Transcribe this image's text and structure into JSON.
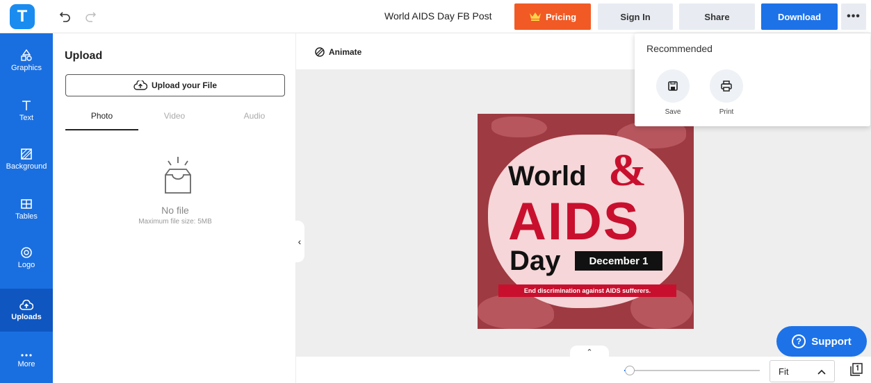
{
  "header": {
    "logo_letter": "T",
    "doc_title": "World AIDS Day FB Post",
    "pricing_label": "Pricing",
    "signin_label": "Sign In",
    "share_label": "Share",
    "download_label": "Download",
    "more_label": "•••"
  },
  "sidebar": {
    "items": [
      {
        "label": "Graphics",
        "icon": "graphics-icon"
      },
      {
        "label": "Text",
        "icon": "text-icon"
      },
      {
        "label": "Background",
        "icon": "background-icon"
      },
      {
        "label": "Tables",
        "icon": "tables-icon"
      },
      {
        "label": "Logo",
        "icon": "logo-icon"
      },
      {
        "label": "Uploads",
        "icon": "cloud-upload-icon",
        "active": true
      },
      {
        "label": "More",
        "icon": "more-icon"
      }
    ]
  },
  "panel": {
    "title": "Upload",
    "upload_button": "Upload your File",
    "tabs": [
      "Photo",
      "Video",
      "Audio"
    ],
    "empty_title": "No file",
    "empty_hint": "Maximum file size: 5MB"
  },
  "toolbar": {
    "animate_label": "Animate"
  },
  "poster": {
    "line1": "World",
    "amp": "&",
    "line2": "AIDS",
    "line3": "Day",
    "date": "December 1",
    "ribbon": "End discrimination against AIDS sufferers."
  },
  "dropdown": {
    "title": "Recommended",
    "items": [
      {
        "label": "Save",
        "icon": "save-icon"
      },
      {
        "label": "Print",
        "icon": "print-icon"
      }
    ]
  },
  "footer": {
    "zoom_value": "Fit",
    "zoom_fraction": 0.04,
    "support_label": "Support"
  },
  "colors": {
    "brand_blue": "#1d72e8",
    "pricing_orange": "#f15a24",
    "nav_blue": "#1a6fe0",
    "poster_red": "#c8102e"
  }
}
